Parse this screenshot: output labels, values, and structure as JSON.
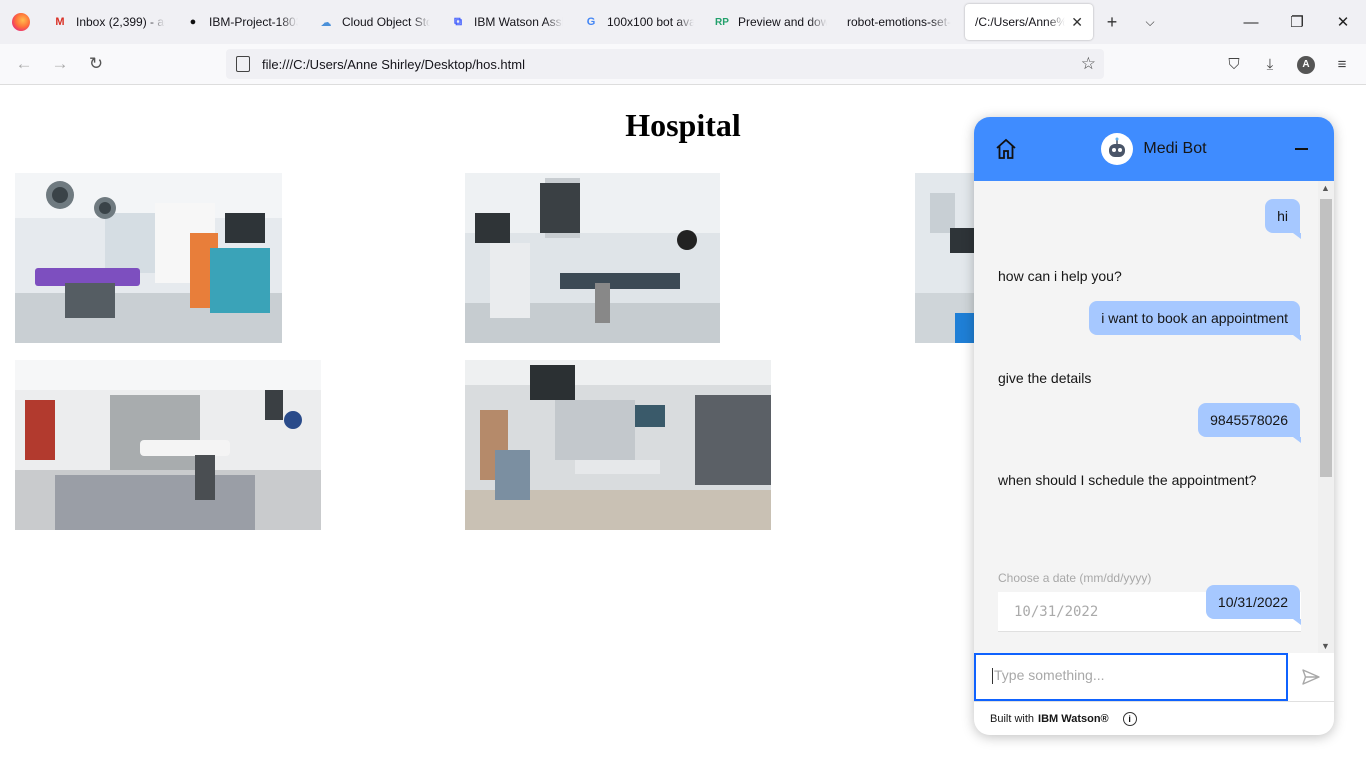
{
  "browser": {
    "tabs": [
      {
        "label": "Inbox (2,399) - ag",
        "icon": "gmail-icon"
      },
      {
        "label": "IBM-Project-1803",
        "icon": "github-icon"
      },
      {
        "label": "Cloud Object Sto",
        "icon": "cloud-icon"
      },
      {
        "label": "IBM Watson Assi",
        "icon": "watson-icon"
      },
      {
        "label": "100x100 bot avat",
        "icon": "google-icon"
      },
      {
        "label": "Preview and dow",
        "icon": "rp-icon"
      },
      {
        "label": "robot-emotions-set-",
        "icon": ""
      },
      {
        "label": "/C:/Users/Anne%2",
        "icon": "",
        "active": true
      }
    ],
    "url": "file:///C:/Users/Anne Shirley/Desktop/hos.html",
    "profile_initial": "A"
  },
  "page": {
    "title": "Hospital"
  },
  "chat": {
    "bot_name": "Medi Bot",
    "messages": [
      {
        "from": "user",
        "text": "hi"
      },
      {
        "from": "bot",
        "text": "how can i help you?"
      },
      {
        "from": "user",
        "text": "i want to book an appointment"
      },
      {
        "from": "bot",
        "text": "give the details"
      },
      {
        "from": "user",
        "text": "9845578026"
      },
      {
        "from": "bot",
        "text": "when should I schedule the appointment?"
      },
      {
        "from": "user",
        "text": "10/31/2022"
      }
    ],
    "date_label": "Choose a date (mm/dd/yyyy)",
    "date_value": "10/31/2022",
    "help_label": "?",
    "input_placeholder": "Type something...",
    "footer_prefix": "Built with",
    "footer_brand": "IBM Watson®",
    "accent_color": "#3f8cff",
    "user_bubble_color": "#a6c8ff"
  }
}
